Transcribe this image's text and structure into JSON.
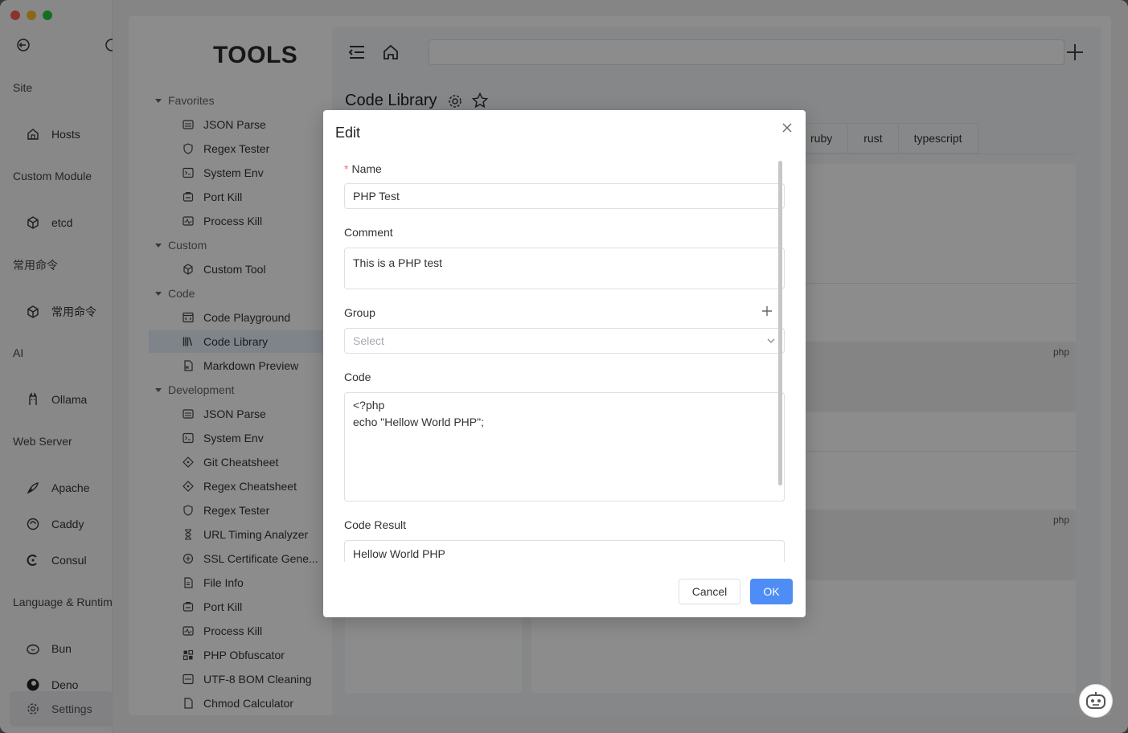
{
  "sidebar": {
    "sections": {
      "site": "Site",
      "custom_module": "Custom Module",
      "common_commands": "常用命令",
      "ai": "AI",
      "web_server": "Web Server",
      "language_runtime": "Language & Runtim"
    },
    "items": {
      "hosts": "Hosts",
      "etcd": "etcd",
      "common_commands": "常用命令",
      "ollama": "Ollama",
      "apache": "Apache",
      "caddy": "Caddy",
      "consul": "Consul",
      "bun": "Bun",
      "deno": "Deno",
      "settings": "Settings"
    }
  },
  "tools": {
    "title": "TOOLS",
    "groups": {
      "favorites": "Favorites",
      "custom": "Custom",
      "code": "Code",
      "development": "Development"
    },
    "favorites": [
      "JSON Parse",
      "Regex Tester",
      "System Env",
      "Port Kill",
      "Process Kill"
    ],
    "custom": [
      "Custom Tool"
    ],
    "code": [
      "Code Playground",
      "Code Library",
      "Markdown Preview"
    ],
    "development": [
      "JSON Parse",
      "System Env",
      "Git Cheatsheet",
      "Regex Cheatsheet",
      "Regex Tester",
      "URL Timing Analyzer",
      "SSL Certificate Gene...",
      "File Info",
      "Port Kill",
      "Process Kill",
      "PHP Obfuscator",
      "UTF-8 BOM Cleaning",
      "Chmod Calculator"
    ]
  },
  "library": {
    "title": "Code Library",
    "tabs": [
      "ruby",
      "rust",
      "typescript"
    ],
    "code_tag_1": "php",
    "code_tag_2": "php"
  },
  "modal": {
    "title": "Edit",
    "name_label": "Name",
    "name_value": "PHP Test",
    "comment_label": "Comment",
    "comment_value": "This is a PHP test",
    "group_label": "Group",
    "group_placeholder": "Select",
    "code_label": "Code",
    "code_value": "<?php\necho \"Hellow World PHP\";",
    "result_label": "Code Result",
    "result_value": "Hellow World PHP",
    "cancel_label": "Cancel",
    "ok_label": "OK"
  },
  "colors": {
    "primary": "#4e8df5",
    "required": "#f56c6c"
  }
}
